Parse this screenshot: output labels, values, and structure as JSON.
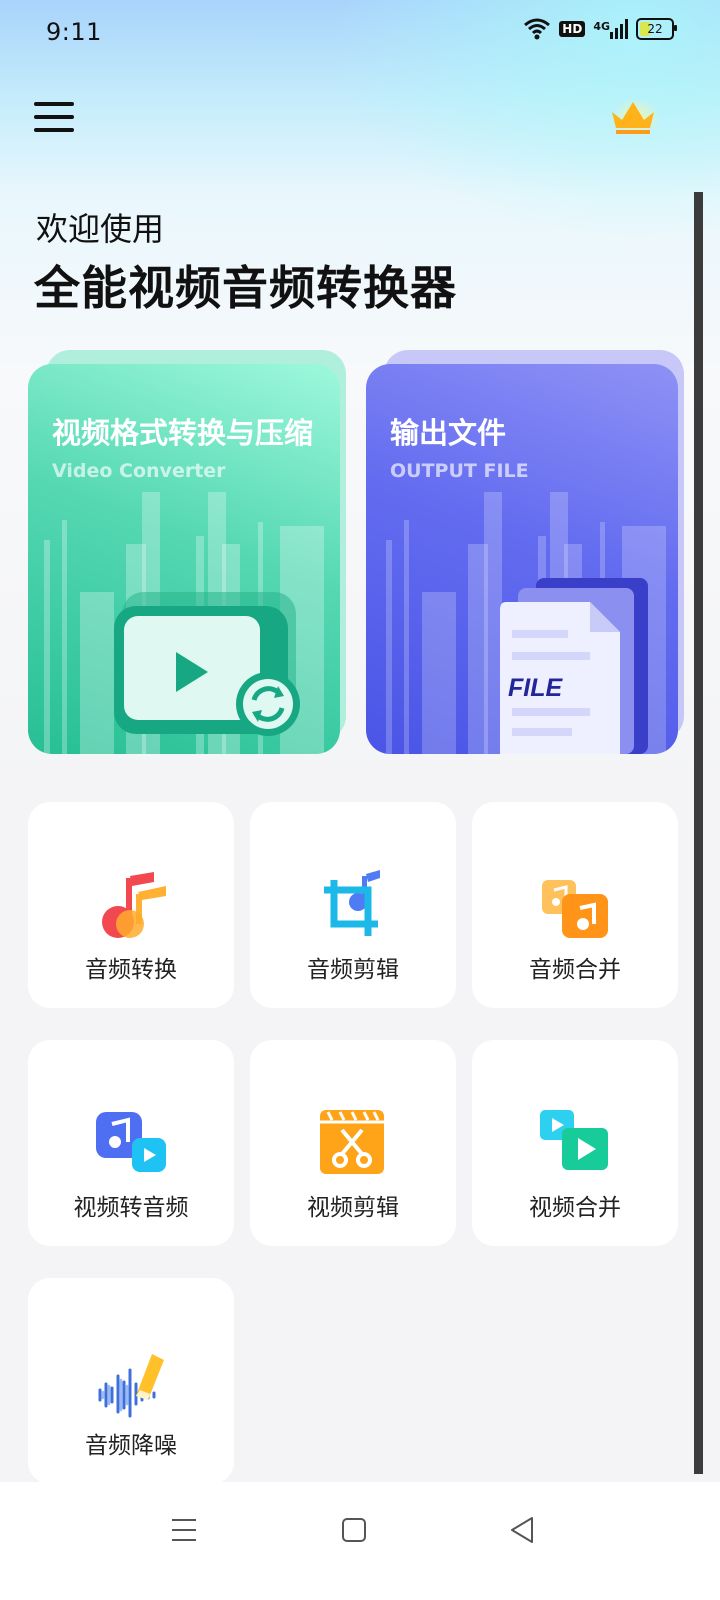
{
  "status_bar": {
    "time": "9:11",
    "hd_label": "HD",
    "network_label": "4G",
    "battery_level": "22"
  },
  "header": {
    "menu_icon": "hamburger-menu-icon",
    "vip_icon": "crown-icon",
    "welcome_text": "欢迎使用",
    "app_title": "全能视频音频转换器"
  },
  "feature_cards": [
    {
      "title": "视频格式转换与压缩",
      "subtitle": "Video Converter",
      "icon": "video-convert-icon",
      "color": "#2fc79c"
    },
    {
      "title": "输出文件",
      "subtitle": "OUTPUT FILE",
      "icon": "file-stack-icon",
      "color": "#5a63ec",
      "art_text": "FILE"
    }
  ],
  "tools": [
    {
      "label": "音频转换",
      "icon": "audio-convert-icon"
    },
    {
      "label": "音频剪辑",
      "icon": "audio-crop-icon"
    },
    {
      "label": "音频合并",
      "icon": "audio-merge-icon"
    },
    {
      "label": "视频转音频",
      "icon": "video-to-audio-icon"
    },
    {
      "label": "视频剪辑",
      "icon": "video-cut-icon"
    },
    {
      "label": "视频合并",
      "icon": "video-merge-icon"
    },
    {
      "label": "音频降噪",
      "icon": "audio-denoise-icon"
    }
  ],
  "nav": [
    "recent-apps-icon",
    "home-icon",
    "back-icon"
  ],
  "colors": {
    "accent_green": "#2fc79c",
    "accent_blue": "#5a63ec",
    "accent_orange": "#ff9b1a"
  }
}
